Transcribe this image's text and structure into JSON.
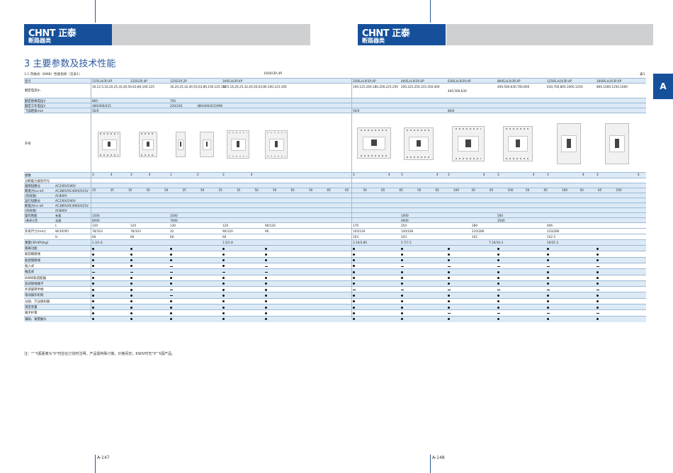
{
  "brand": {
    "logo": "CHNT 正泰",
    "subtitle": "断路器类"
  },
  "section": {
    "title": "3 主要参数及技术性能"
  },
  "caption": "3.1 热磁式（NM8）性能指标（见表1）",
  "ref_text": "1600/3P,4P",
  "table_ref": "表1",
  "tab_letter": "A",
  "table": {
    "labels": {
      "model": "型号",
      "rated_current": "额定电流In",
      "rated_insulation": "额定绝缘电压V",
      "rated_voltage": "额定工作电压V",
      "arc_distance": "飞弧距离mm",
      "appearance": "外形",
      "poles": "极数",
      "breaking_code": "分断能力级别代号",
      "limit_breaking": "极限短路分",
      "breaking_capacity_icu": "断能力Icu kA",
      "dc_row": "(有效值)",
      "service_breaking": "运行短路分",
      "breaking_capacity_ics": "断能力Ics kA",
      "dc_row2": "(有效值)",
      "op_performance": "操作性能",
      "times": "(寿命)/次",
      "with_power": "有载",
      "no_power": "无载",
      "dimensions": "外形尺寸(mm)",
      "weight": "重量(3P/4P)(kg)",
      "voltage_a": "AC230V/240V",
      "voltage_b": "AC380V/AC400V/415V",
      "voltage_c": "AC800V",
      "dim_l": "L",
      "dim_w": "W(3P/4P)",
      "dim_h": "H"
    },
    "models": [
      "125S,H/3P,4P",
      "125S/3P,4P",
      "125S/1P,2P",
      "160S,H/3P,4P",
      "250S,H,R/3P,4P",
      "400S,H,R/3P,4P",
      "630S,H,R/3P,4P",
      "800S,H,R/3P,4P",
      "1250S,H,R/3P,4P",
      "1600S,H,R/3P,4P"
    ],
    "currents": [
      "16,12.5,16,20,25,32,40,50,63,80,100,125",
      "16,20,25,32,40,50,63,80,100,125,160",
      "12.5,16,20,25,32,40,50,63,80,100,125,160",
      "100,125,160,180,200,225,250",
      "200,225,250,315,350,400",
      "400,500,630",
      "400,500,630,700,800",
      "630,700,800,1000,1250",
      "800,1000,1250,1600"
    ],
    "insulation": [
      "800",
      "750"
    ],
    "op_voltage": [
      "380/400/415",
      "220/240",
      "380/400/415/690"
    ],
    "arc": [
      "50/0",
      "50/0",
      "80/0"
    ],
    "poles_row": [
      "3",
      "4",
      "3",
      "4",
      "1",
      "2",
      "3",
      "4",
      "3",
      "4",
      "3",
      "4",
      "3",
      "4",
      "3",
      "4",
      "3",
      "4",
      "3",
      "4"
    ],
    "dc_icu": [
      "25",
      "35",
      "35",
      "50",
      "50",
      "25",
      "50",
      "25",
      "35",
      "50",
      "50",
      "65",
      "50",
      "65",
      "65",
      "50",
      "65",
      "65",
      "50",
      "65",
      "100",
      "50",
      "65",
      "100",
      "50",
      "65",
      "100",
      "50",
      "65",
      "100"
    ],
    "ops_with": [
      "1500",
      "1500",
      "1000",
      "500"
    ],
    "ops_without": [
      "8500",
      "7000",
      "4000",
      "2500"
    ],
    "dim_L": [
      "120",
      "120",
      "130",
      "120",
      "90/120",
      "176",
      "254",
      "280",
      "406"
    ],
    "dim_W": [
      "78/103",
      "78/103",
      "32",
      "90/120",
      "90",
      "105/140",
      "140/184",
      "210/280",
      "210/280"
    ],
    "dim_H": [
      "60",
      "60",
      "60",
      "60",
      "103",
      "103",
      "102",
      "142.5"
    ],
    "weights": [
      "1.3/1.6",
      "1.5/1.8",
      "3.10/3.85",
      "5.7/7.2",
      "7.10/10.3",
      "19/25.3"
    ],
    "accessories": [
      "隔离功能",
      "板前隔接线",
      "板后隔接线",
      "插入式",
      "抽出式",
      "DIN导轨适配器",
      "双式接线端子",
      "外部旋转手柄",
      "电动操作机构",
      "分励、欠压脱扣器",
      "锁定装置",
      "端子护罩",
      "辅助、报警触头"
    ]
  },
  "note": "注：\"\"飞弧距离为\"0\"时应在订货时注明，产品需特殊订做，价格另定；690V时无\"0\"飞弧产品。",
  "pages": {
    "left": "A-147",
    "right": "A-148"
  }
}
